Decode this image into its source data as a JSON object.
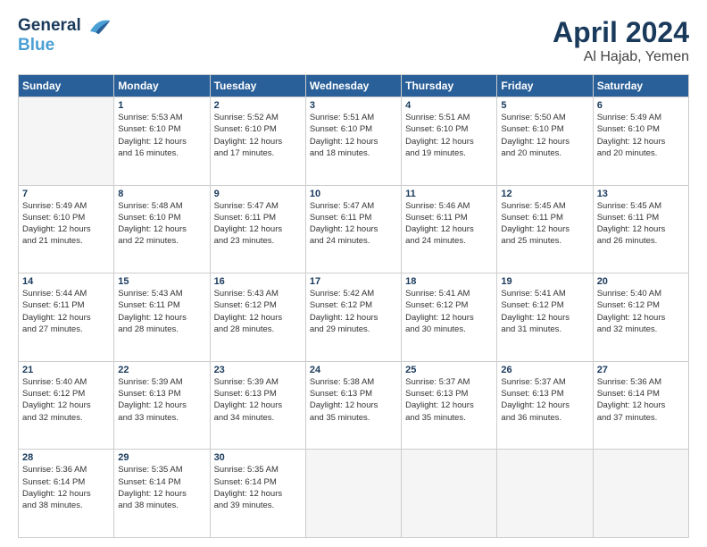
{
  "logo": {
    "line1": "General",
    "line2": "Blue"
  },
  "title": "April 2024",
  "location": "Al Hajab, Yemen",
  "weekdays": [
    "Sunday",
    "Monday",
    "Tuesday",
    "Wednesday",
    "Thursday",
    "Friday",
    "Saturday"
  ],
  "weeks": [
    [
      {
        "day": "",
        "info": ""
      },
      {
        "day": "1",
        "info": "Sunrise: 5:53 AM\nSunset: 6:10 PM\nDaylight: 12 hours\nand 16 minutes."
      },
      {
        "day": "2",
        "info": "Sunrise: 5:52 AM\nSunset: 6:10 PM\nDaylight: 12 hours\nand 17 minutes."
      },
      {
        "day": "3",
        "info": "Sunrise: 5:51 AM\nSunset: 6:10 PM\nDaylight: 12 hours\nand 18 minutes."
      },
      {
        "day": "4",
        "info": "Sunrise: 5:51 AM\nSunset: 6:10 PM\nDaylight: 12 hours\nand 19 minutes."
      },
      {
        "day": "5",
        "info": "Sunrise: 5:50 AM\nSunset: 6:10 PM\nDaylight: 12 hours\nand 20 minutes."
      },
      {
        "day": "6",
        "info": "Sunrise: 5:49 AM\nSunset: 6:10 PM\nDaylight: 12 hours\nand 20 minutes."
      }
    ],
    [
      {
        "day": "7",
        "info": "Sunrise: 5:49 AM\nSunset: 6:10 PM\nDaylight: 12 hours\nand 21 minutes."
      },
      {
        "day": "8",
        "info": "Sunrise: 5:48 AM\nSunset: 6:10 PM\nDaylight: 12 hours\nand 22 minutes."
      },
      {
        "day": "9",
        "info": "Sunrise: 5:47 AM\nSunset: 6:11 PM\nDaylight: 12 hours\nand 23 minutes."
      },
      {
        "day": "10",
        "info": "Sunrise: 5:47 AM\nSunset: 6:11 PM\nDaylight: 12 hours\nand 24 minutes."
      },
      {
        "day": "11",
        "info": "Sunrise: 5:46 AM\nSunset: 6:11 PM\nDaylight: 12 hours\nand 24 minutes."
      },
      {
        "day": "12",
        "info": "Sunrise: 5:45 AM\nSunset: 6:11 PM\nDaylight: 12 hours\nand 25 minutes."
      },
      {
        "day": "13",
        "info": "Sunrise: 5:45 AM\nSunset: 6:11 PM\nDaylight: 12 hours\nand 26 minutes."
      }
    ],
    [
      {
        "day": "14",
        "info": "Sunrise: 5:44 AM\nSunset: 6:11 PM\nDaylight: 12 hours\nand 27 minutes."
      },
      {
        "day": "15",
        "info": "Sunrise: 5:43 AM\nSunset: 6:11 PM\nDaylight: 12 hours\nand 28 minutes."
      },
      {
        "day": "16",
        "info": "Sunrise: 5:43 AM\nSunset: 6:12 PM\nDaylight: 12 hours\nand 28 minutes."
      },
      {
        "day": "17",
        "info": "Sunrise: 5:42 AM\nSunset: 6:12 PM\nDaylight: 12 hours\nand 29 minutes."
      },
      {
        "day": "18",
        "info": "Sunrise: 5:41 AM\nSunset: 6:12 PM\nDaylight: 12 hours\nand 30 minutes."
      },
      {
        "day": "19",
        "info": "Sunrise: 5:41 AM\nSunset: 6:12 PM\nDaylight: 12 hours\nand 31 minutes."
      },
      {
        "day": "20",
        "info": "Sunrise: 5:40 AM\nSunset: 6:12 PM\nDaylight: 12 hours\nand 32 minutes."
      }
    ],
    [
      {
        "day": "21",
        "info": "Sunrise: 5:40 AM\nSunset: 6:12 PM\nDaylight: 12 hours\nand 32 minutes."
      },
      {
        "day": "22",
        "info": "Sunrise: 5:39 AM\nSunset: 6:13 PM\nDaylight: 12 hours\nand 33 minutes."
      },
      {
        "day": "23",
        "info": "Sunrise: 5:39 AM\nSunset: 6:13 PM\nDaylight: 12 hours\nand 34 minutes."
      },
      {
        "day": "24",
        "info": "Sunrise: 5:38 AM\nSunset: 6:13 PM\nDaylight: 12 hours\nand 35 minutes."
      },
      {
        "day": "25",
        "info": "Sunrise: 5:37 AM\nSunset: 6:13 PM\nDaylight: 12 hours\nand 35 minutes."
      },
      {
        "day": "26",
        "info": "Sunrise: 5:37 AM\nSunset: 6:13 PM\nDaylight: 12 hours\nand 36 minutes."
      },
      {
        "day": "27",
        "info": "Sunrise: 5:36 AM\nSunset: 6:14 PM\nDaylight: 12 hours\nand 37 minutes."
      }
    ],
    [
      {
        "day": "28",
        "info": "Sunrise: 5:36 AM\nSunset: 6:14 PM\nDaylight: 12 hours\nand 38 minutes."
      },
      {
        "day": "29",
        "info": "Sunrise: 5:35 AM\nSunset: 6:14 PM\nDaylight: 12 hours\nand 38 minutes."
      },
      {
        "day": "30",
        "info": "Sunrise: 5:35 AM\nSunset: 6:14 PM\nDaylight: 12 hours\nand 39 minutes."
      },
      {
        "day": "",
        "info": ""
      },
      {
        "day": "",
        "info": ""
      },
      {
        "day": "",
        "info": ""
      },
      {
        "day": "",
        "info": ""
      }
    ]
  ]
}
